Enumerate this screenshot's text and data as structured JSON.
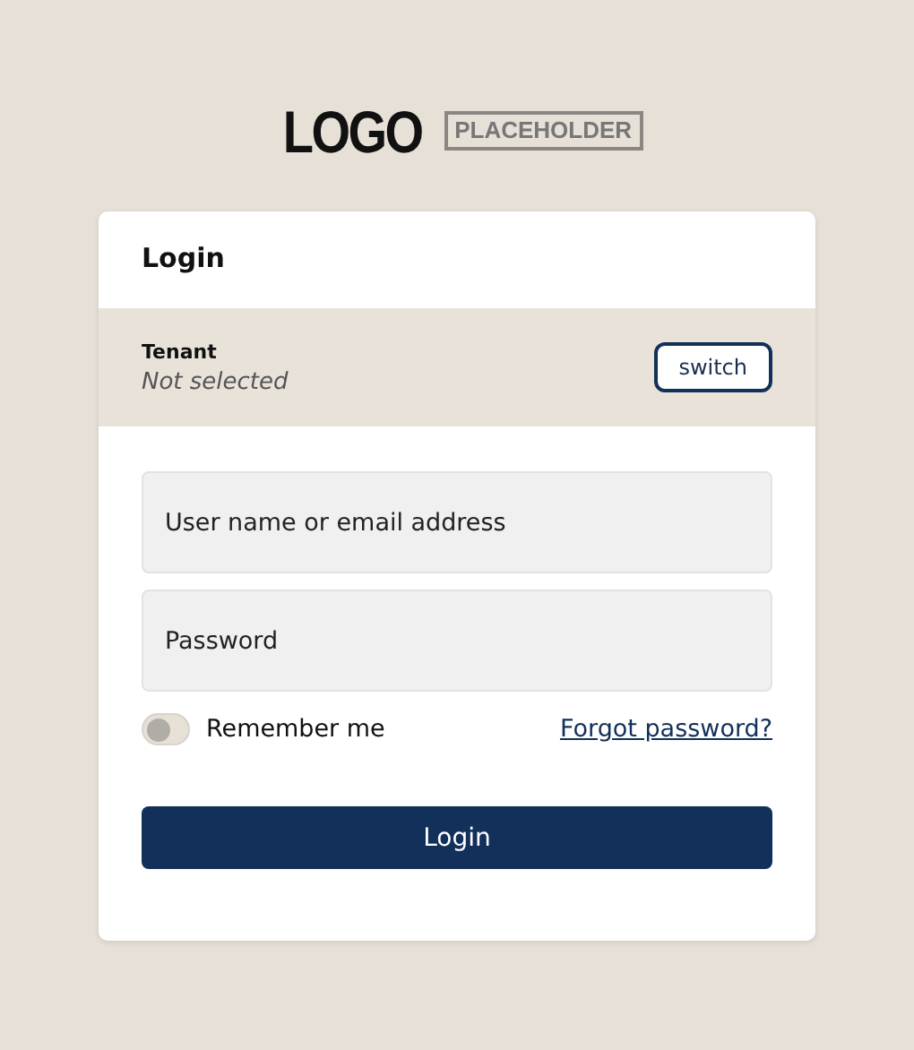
{
  "logo": {
    "main": "LOGO",
    "tag": "PLACEHOLDER"
  },
  "card": {
    "title": "Login",
    "tenant": {
      "label": "Tenant",
      "value": "Not selected",
      "button": "switch"
    },
    "fields": [
      {
        "placeholder": "User name or email address"
      },
      {
        "placeholder": "Password"
      }
    ],
    "remember": {
      "label": "Remember me",
      "on": false
    },
    "forgot_link": "Forgot password?",
    "submit": "Login"
  }
}
